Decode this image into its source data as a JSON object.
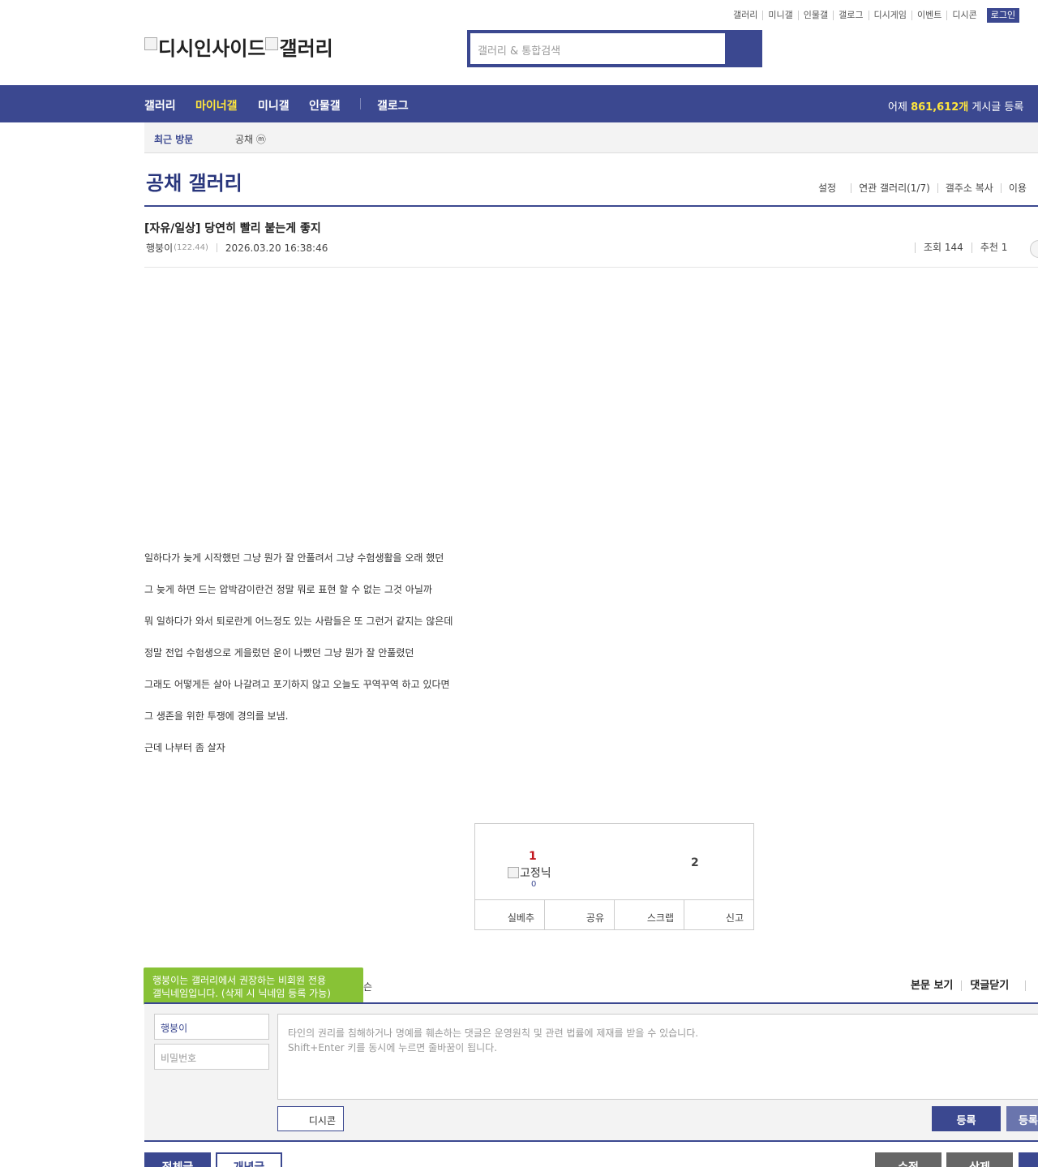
{
  "top_links": [
    "갤러리",
    "미니갤",
    "인물갤",
    "갤로그",
    "디시게임",
    "이벤트",
    "디시콘"
  ],
  "login_label": "로그인",
  "logo": {
    "part1": "디시인사이드",
    "part2": "갤러리"
  },
  "search": {
    "placeholder": "갤러리 & 통합검색"
  },
  "nav": {
    "items": [
      {
        "label": "갤러리",
        "active": false
      },
      {
        "label": "마이너갤",
        "active": true
      },
      {
        "label": "미니갤",
        "active": false
      },
      {
        "label": "인물갤",
        "active": false
      },
      {
        "label": "갤로그",
        "active": false
      }
    ],
    "stat_prefix": "어제",
    "stat_count": "861,612개",
    "stat_suffix": "게시글 등록"
  },
  "recent": {
    "label": "최근 방문",
    "item": "공채 ⓜ"
  },
  "gallery": {
    "title": "공채 갤러리",
    "menu": [
      "설정",
      "연관 갤러리(1/7)",
      "갤주소 복사",
      "이용"
    ]
  },
  "post": {
    "title": "[자유/일상] 당연히 빨리 붙는게 좋지",
    "writer": "행붕이",
    "ip": "(122.44)",
    "date": "2026.03.20 16:38:46",
    "views": "조회 144",
    "recommends": "추천 1",
    "body": [
      "일하다가 늦게 시작했던 그냥 뭔가 잘 안풀려서 그냥 수험생활을 오래 했던",
      "그 늦게 하면 드는 압박감이란건 정말 뭐로 표현 할 수 없는 그것 아닐까",
      "뭐 일하다가 와서 퇴로란게 어느정도 있는 사람들은 또 그런거 같지는 않은데",
      "정말 전업 수험생으로 게을렀던 운이 나빴던 그냥 뭔가 잘 안풀렸던",
      "그래도 어떻게든 살아 나갈려고 포기하지 않고 오늘도 꾸역꾸역 하고 있다면",
      "그 생존을 위한 투쟁에 경의를 보냄.",
      "근데 나부터 좀 살자"
    ]
  },
  "recommend_box": {
    "up_count": "1",
    "down_count": "2",
    "fixed_nick": "고정닉",
    "fixed_count": "0",
    "buttons": [
      "실베추",
      "공유",
      "스크랩",
      "신고"
    ],
    "colors": {
      "up": "#c2161e",
      "accent": "#3b4890"
    }
  },
  "comments": {
    "tooltip_line1": "행붕이는 갤러리에서 권장하는 비회원 전용",
    "tooltip_line2": "갤닉네임입니다. (삭제 시 닉네임 등록 가능)",
    "header_tail": "슨",
    "menu": [
      "본문 보기",
      "댓글닫기"
    ],
    "nick_value": "행붕이",
    "password_placeholder": "비밀번호",
    "textarea_line1": "타인의 권리를 침해하거나 명예를 훼손하는 댓글은 운영원칙 및 관련 법률에 제재를 받을 수 있습니다.",
    "textarea_line2": "Shift+Enter 키를 동시에 누르면 줄바꿈이 됩니다.",
    "dccon_label": "디시콘",
    "submit_label": "등록",
    "submit2_label": "등록"
  },
  "bottom_buttons": {
    "all": "전체글",
    "best": "개념글",
    "edit": "수정",
    "delete": "삭제"
  },
  "colors": {
    "brand": "#3b4890",
    "highlight": "#ffe63c",
    "tooltip": "#88c236"
  }
}
